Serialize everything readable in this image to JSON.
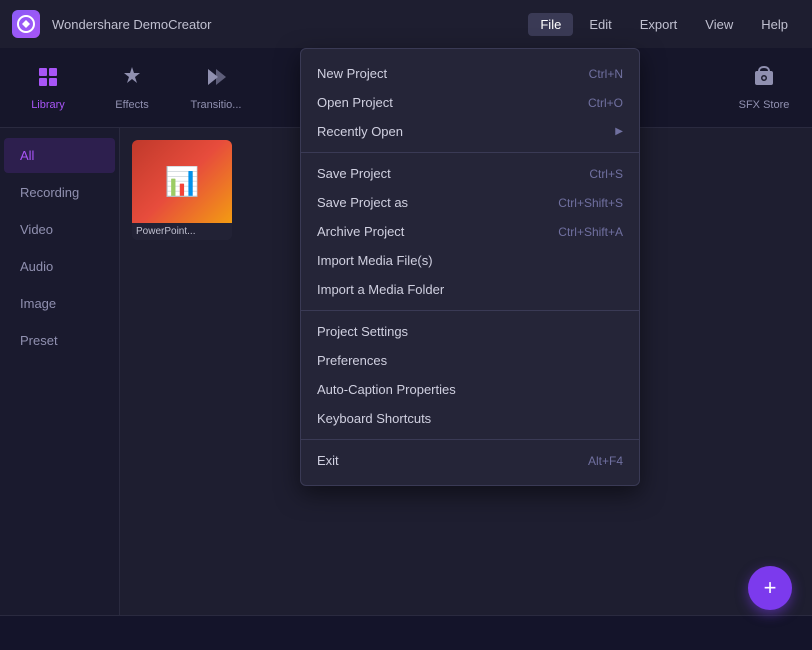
{
  "app": {
    "logo": "W",
    "title": "Wondershare DemoCreator"
  },
  "menubar": {
    "items": [
      {
        "label": "File",
        "active": true
      },
      {
        "label": "Edit",
        "active": false
      },
      {
        "label": "Export",
        "active": false
      },
      {
        "label": "View",
        "active": false
      },
      {
        "label": "Help",
        "active": false
      }
    ]
  },
  "toolbar": {
    "items": [
      {
        "id": "library",
        "label": "Library",
        "icon": "🗂️",
        "active": true
      },
      {
        "id": "effects",
        "label": "Effects",
        "icon": "✨",
        "active": false
      },
      {
        "id": "transitions",
        "label": "Transitio...",
        "icon": "⏩",
        "active": false
      }
    ],
    "sfx_store": {
      "label": "SFX Store",
      "icon": "🎧"
    }
  },
  "sidebar": {
    "items": [
      {
        "id": "all",
        "label": "All",
        "active": true
      },
      {
        "id": "recording",
        "label": "Recording",
        "active": false
      },
      {
        "id": "video",
        "label": "Video",
        "active": false
      },
      {
        "id": "audio",
        "label": "Audio",
        "active": false
      },
      {
        "id": "image",
        "label": "Image",
        "active": false
      },
      {
        "id": "preset",
        "label": "Preset",
        "active": false
      }
    ]
  },
  "content": {
    "media_items": [
      {
        "label": "PowerPoint...",
        "icon": "📊",
        "color1": "#c0392b",
        "color2": "#e74c3c"
      }
    ]
  },
  "file_menu": {
    "sections": [
      {
        "items": [
          {
            "label": "New Project",
            "shortcut": "Ctrl+N",
            "arrow": false
          },
          {
            "label": "Open Project",
            "shortcut": "Ctrl+O",
            "arrow": false
          },
          {
            "label": "Recently Open",
            "shortcut": "",
            "arrow": true
          }
        ]
      },
      {
        "items": [
          {
            "label": "Save Project",
            "shortcut": "Ctrl+S",
            "arrow": false
          },
          {
            "label": "Save Project as",
            "shortcut": "Ctrl+Shift+S",
            "arrow": false
          },
          {
            "label": "Archive Project",
            "shortcut": "Ctrl+Shift+A",
            "arrow": false
          },
          {
            "label": "Import Media File(s)",
            "shortcut": "",
            "arrow": false
          },
          {
            "label": "Import a Media Folder",
            "shortcut": "",
            "arrow": false
          }
        ]
      },
      {
        "items": [
          {
            "label": "Project Settings",
            "shortcut": "",
            "arrow": false
          },
          {
            "label": "Preferences",
            "shortcut": "",
            "arrow": false
          },
          {
            "label": "Auto-Caption Properties",
            "shortcut": "",
            "arrow": false
          },
          {
            "label": "Keyboard Shortcuts",
            "shortcut": "",
            "arrow": false
          }
        ]
      },
      {
        "items": [
          {
            "label": "Exit",
            "shortcut": "Alt+F4",
            "arrow": false
          }
        ]
      }
    ]
  },
  "fab": {
    "icon": "+"
  }
}
